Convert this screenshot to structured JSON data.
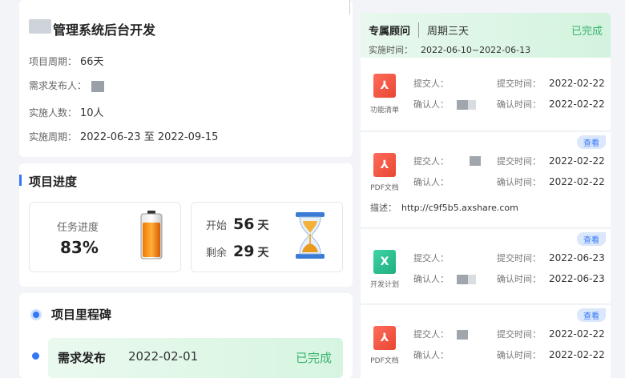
{
  "project": {
    "title": "管理系统后台开发",
    "cycle_label": "项目周期：",
    "cycle_value": "66天",
    "publisher_label": "需求发布人：",
    "people_label": "实施人数：",
    "people_value": "10人",
    "period_label": "实施周期：",
    "period_value": "2022-06-23 至 2022-09-15"
  },
  "progress": {
    "section_title": "项目进度",
    "task_label": "任务进度",
    "task_value": "83%",
    "task_fraction": 0.83,
    "start_label": "开始",
    "start_value": "56",
    "remain_label": "剩余",
    "remain_value": "29",
    "day_unit": "天"
  },
  "milestone": {
    "section_title": "项目里程碑",
    "item_name": "需求发布",
    "item_date": "2022-02-01",
    "item_status": "已完成"
  },
  "consultant": {
    "title": "专属顾问",
    "period": "周期三天",
    "status": "已完成",
    "time_label": "实施时间：",
    "time_value": "2022-06-10~2022-06-13"
  },
  "labels": {
    "submitter": "提交人：",
    "confirmer": "确认人：",
    "submit_time": "提交时间：",
    "confirm_time": "确认时间：",
    "desc": "描述：",
    "tag": "查看"
  },
  "docs": [
    {
      "file": "功能清单",
      "icon": "pdf-icon",
      "submit_time": "2022-02-22",
      "confirm_time": "2022-02-22"
    },
    {
      "file": "PDF文档",
      "icon": "pdf-icon",
      "submit_time": "2022-02-22",
      "confirm_time": "2022-02-22",
      "desc": "http://c9f5b5.axshare.com"
    },
    {
      "file": "开发计划",
      "icon": "excel-icon",
      "submit_time": "2022-06-23",
      "confirm_time": "2022-06-23"
    },
    {
      "file": "PDF文档",
      "icon": "pdf-icon",
      "submit_time": "2022-02-22",
      "confirm_time": "2022-02-22"
    }
  ],
  "colors": {
    "accent": "#3478f6",
    "success": "#3cb371",
    "pdf": "#e84733",
    "excel": "#1fae80"
  }
}
